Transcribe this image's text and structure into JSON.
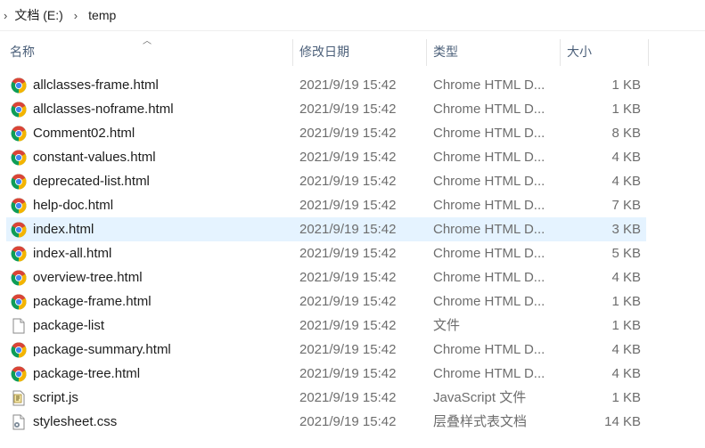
{
  "breadcrumb": {
    "items": [
      {
        "label": "文档 (E:)"
      },
      {
        "label": "temp"
      }
    ]
  },
  "columns": {
    "name": "名称",
    "date": "修改日期",
    "type": "类型",
    "size": "大小",
    "sorted_by": "name"
  },
  "files": [
    {
      "name": "allclasses-frame.html",
      "date": "2021/9/19 15:42",
      "type": "Chrome HTML D...",
      "size": "1 KB",
      "icon": "chrome-icon"
    },
    {
      "name": "allclasses-noframe.html",
      "date": "2021/9/19 15:42",
      "type": "Chrome HTML D...",
      "size": "1 KB",
      "icon": "chrome-icon"
    },
    {
      "name": "Comment02.html",
      "date": "2021/9/19 15:42",
      "type": "Chrome HTML D...",
      "size": "8 KB",
      "icon": "chrome-icon"
    },
    {
      "name": "constant-values.html",
      "date": "2021/9/19 15:42",
      "type": "Chrome HTML D...",
      "size": "4 KB",
      "icon": "chrome-icon"
    },
    {
      "name": "deprecated-list.html",
      "date": "2021/9/19 15:42",
      "type": "Chrome HTML D...",
      "size": "4 KB",
      "icon": "chrome-icon"
    },
    {
      "name": "help-doc.html",
      "date": "2021/9/19 15:42",
      "type": "Chrome HTML D...",
      "size": "7 KB",
      "icon": "chrome-icon"
    },
    {
      "name": "index.html",
      "date": "2021/9/19 15:42",
      "type": "Chrome HTML D...",
      "size": "3 KB",
      "icon": "chrome-icon",
      "hover": true
    },
    {
      "name": "index-all.html",
      "date": "2021/9/19 15:42",
      "type": "Chrome HTML D...",
      "size": "5 KB",
      "icon": "chrome-icon"
    },
    {
      "name": "overview-tree.html",
      "date": "2021/9/19 15:42",
      "type": "Chrome HTML D...",
      "size": "4 KB",
      "icon": "chrome-icon"
    },
    {
      "name": "package-frame.html",
      "date": "2021/9/19 15:42",
      "type": "Chrome HTML D...",
      "size": "1 KB",
      "icon": "chrome-icon"
    },
    {
      "name": "package-list",
      "date": "2021/9/19 15:42",
      "type": "文件",
      "size": "1 KB",
      "icon": "blank-file-icon"
    },
    {
      "name": "package-summary.html",
      "date": "2021/9/19 15:42",
      "type": "Chrome HTML D...",
      "size": "4 KB",
      "icon": "chrome-icon"
    },
    {
      "name": "package-tree.html",
      "date": "2021/9/19 15:42",
      "type": "Chrome HTML D...",
      "size": "4 KB",
      "icon": "chrome-icon"
    },
    {
      "name": "script.js",
      "date": "2021/9/19 15:42",
      "type": "JavaScript 文件",
      "size": "1 KB",
      "icon": "script-file-icon"
    },
    {
      "name": "stylesheet.css",
      "date": "2021/9/19 15:42",
      "type": "层叠样式表文档",
      "size": "14 KB",
      "icon": "css-file-icon"
    }
  ],
  "colors": {
    "hover_row": "#e5f3ff",
    "header_text": "#4c607a",
    "chrome_red": "#db4437",
    "chrome_green": "#0f9d58",
    "chrome_yellow": "#f4b400",
    "chrome_blue": "#4285f4"
  }
}
